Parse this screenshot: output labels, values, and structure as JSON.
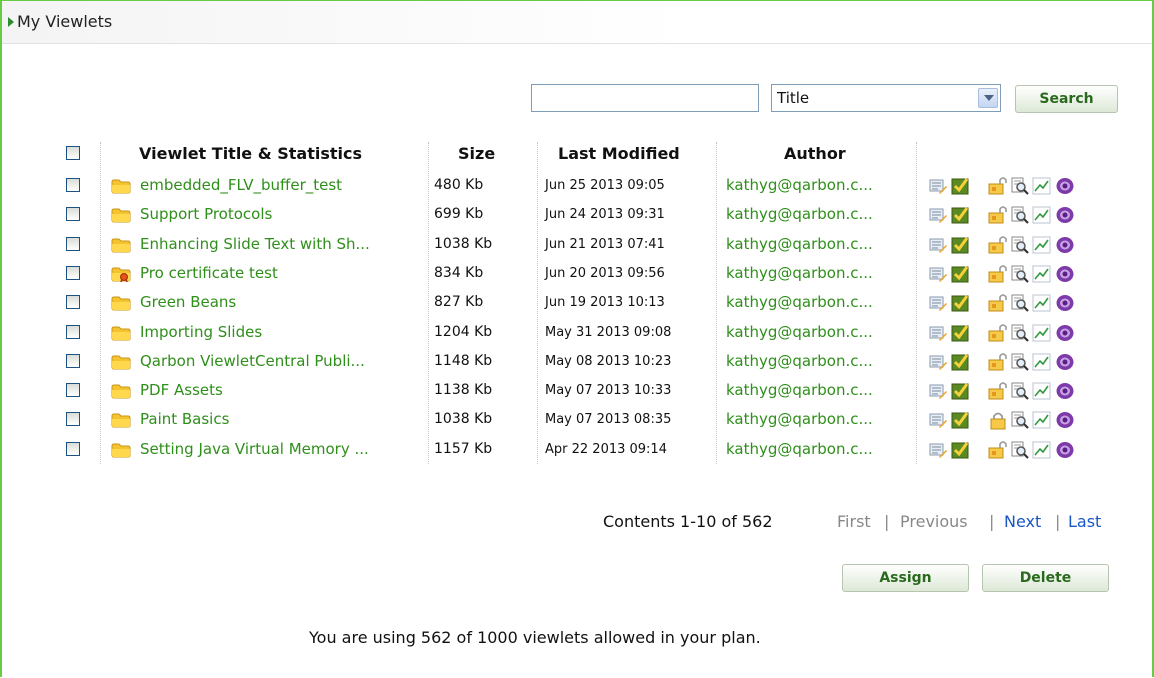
{
  "header": {
    "title": "My Viewlets"
  },
  "search": {
    "input_value": "",
    "field_selected": "Title",
    "button_label": "Search"
  },
  "table": {
    "headers": {
      "title": "Viewlet Title & Statistics",
      "size": "Size",
      "modified": "Last Modified",
      "author": "Author"
    },
    "rows": [
      {
        "title": "embedded_FLV_buffer_test",
        "size": "480 Kb",
        "date": "Jun 25 2013 09:05",
        "author": "kathyg@qarbon.c...",
        "folder": "normal",
        "locked": false
      },
      {
        "title": "Support Protocols",
        "size": "699 Kb",
        "date": "Jun 24 2013 09:31",
        "author": "kathyg@qarbon.c...",
        "folder": "normal",
        "locked": false
      },
      {
        "title": "Enhancing Slide Text with Sh...",
        "size": "1038 Kb",
        "date": "Jun 21 2013 07:41",
        "author": "kathyg@qarbon.c...",
        "folder": "normal",
        "locked": false
      },
      {
        "title": "Pro certificate test",
        "size": "834 Kb",
        "date": "Jun 20 2013 09:56",
        "author": "kathyg@qarbon.c...",
        "folder": "certificate",
        "locked": false
      },
      {
        "title": "Green Beans",
        "size": "827 Kb",
        "date": "Jun 19 2013 10:13",
        "author": "kathyg@qarbon.c...",
        "folder": "normal",
        "locked": false
      },
      {
        "title": "Importing Slides",
        "size": "1204 Kb",
        "date": "May 31 2013 09:08",
        "author": "kathyg@qarbon.c...",
        "folder": "normal",
        "locked": false
      },
      {
        "title": "Qarbon ViewletCentral Publi...",
        "size": "1148 Kb",
        "date": "May 08 2013 10:23",
        "author": "kathyg@qarbon.c...",
        "folder": "normal",
        "locked": false
      },
      {
        "title": "PDF Assets",
        "size": "1138 Kb",
        "date": "May 07 2013 10:33",
        "author": "kathyg@qarbon.c...",
        "folder": "normal",
        "locked": false
      },
      {
        "title": "Paint Basics",
        "size": "1038 Kb",
        "date": "May 07 2013 08:35",
        "author": "kathyg@qarbon.c...",
        "folder": "normal",
        "locked": true
      },
      {
        "title": "Setting Java Virtual Memory ...",
        "size": "1157 Kb",
        "date": "Apr 22 2013 09:14",
        "author": "kathyg@qarbon.c...",
        "folder": "normal",
        "locked": false
      }
    ],
    "row_icons": [
      "edit-icon",
      "approve-icon",
      "share-lock-icon",
      "preview-icon",
      "statistics-icon",
      "player-icon"
    ]
  },
  "pager": {
    "info": "Contents 1-10 of 562",
    "first": "First",
    "previous": "Previous",
    "next": "Next",
    "last": "Last",
    "sep": "|"
  },
  "actions": {
    "assign": "Assign",
    "delete": "Delete"
  },
  "usage": "You are using 562 of 1000 viewlets allowed in your plan.",
  "colors": {
    "link_green": "#2f8f1b",
    "link_blue": "#1a56c8",
    "disabled_gray": "#888888",
    "frame_green": "#66cc44"
  }
}
